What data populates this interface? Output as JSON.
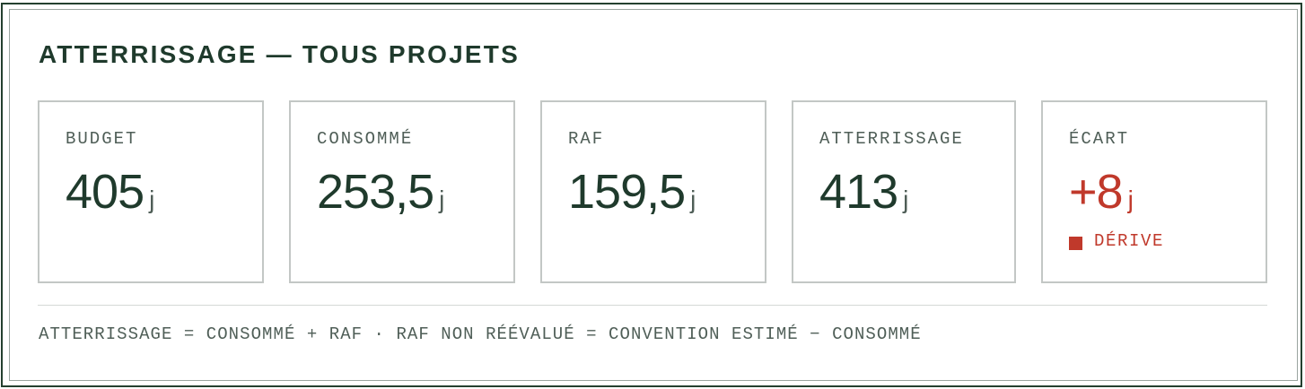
{
  "panel": {
    "title": "ATTERRISSAGE — TOUS PROJETS"
  },
  "cards": [
    {
      "label": "BUDGET",
      "value": "405",
      "unit": "j"
    },
    {
      "label": "CONSOMMÉ",
      "value": "253,5",
      "unit": "j"
    },
    {
      "label": "RAF",
      "value": "159,5",
      "unit": "j"
    },
    {
      "label": "ATTERRISSAGE",
      "value": "413",
      "unit": "j"
    },
    {
      "label": "ÉCART",
      "value": "+8",
      "unit": "j",
      "status": "DÉRIVE"
    }
  ],
  "footnote": "ATTERRISSAGE = CONSOMMÉ + RAF · RAF NON RÉÉVALUÉ = CONVENTION ESTIMÉ − CONSOMMÉ",
  "colors": {
    "primary_text": "#1f3a2c",
    "secondary_text": "#4f5e57",
    "alert": "#c0392b",
    "frame": "#24402f"
  },
  "icons": {
    "status_indicator": "square-status-icon"
  }
}
